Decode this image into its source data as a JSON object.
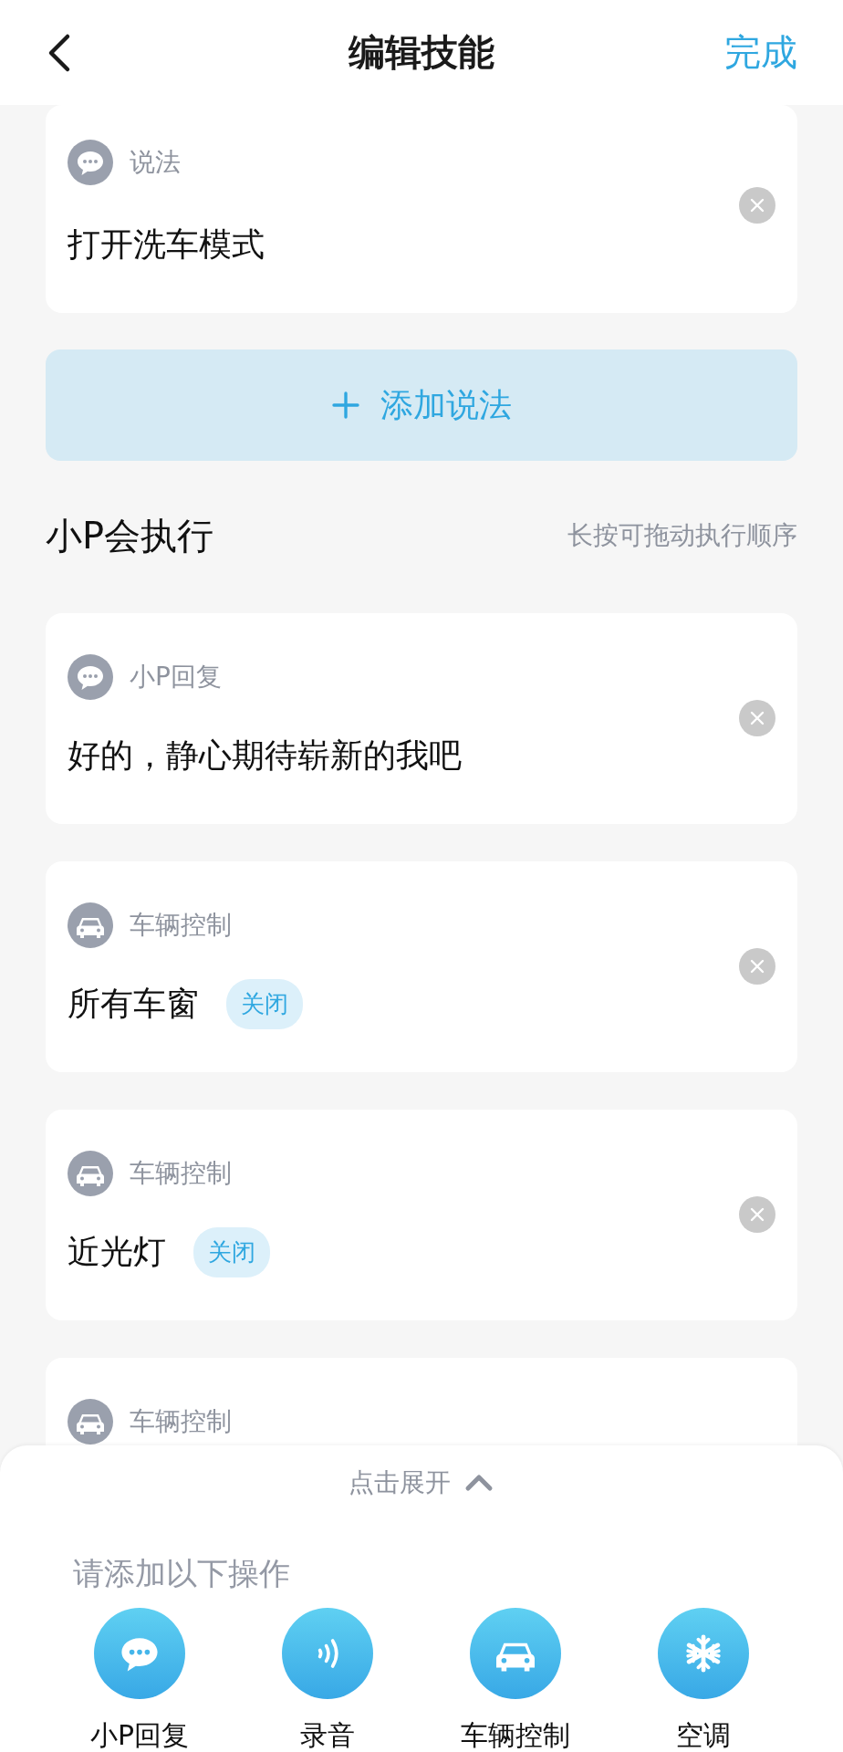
{
  "header": {
    "title": "编辑技能",
    "done": "完成"
  },
  "utterance": {
    "kind": "reply",
    "label": "说法",
    "text": "打开洗车模式"
  },
  "add_button": {
    "label": "添加说法"
  },
  "section": {
    "title": "小P会执行",
    "hint": "长按可拖动执行顺序"
  },
  "actions": [
    {
      "kind": "reply",
      "label": "小P回复",
      "text": "好的，静心期待崭新的我吧"
    },
    {
      "kind": "vehicle",
      "label": "车辆控制",
      "text": "所有车窗",
      "tag": "关闭"
    },
    {
      "kind": "vehicle",
      "label": "车辆控制",
      "text": "近光灯",
      "tag": "关闭"
    },
    {
      "kind": "vehicle",
      "label": "车辆控制"
    }
  ],
  "sheet": {
    "toggle": "点击展开",
    "prompt": "请添加以下操作",
    "options": [
      {
        "kind": "reply",
        "label": "小P回复"
      },
      {
        "kind": "record",
        "label": "录音"
      },
      {
        "kind": "vehicle",
        "label": "车辆控制"
      },
      {
        "kind": "climate",
        "label": "空调"
      }
    ]
  }
}
